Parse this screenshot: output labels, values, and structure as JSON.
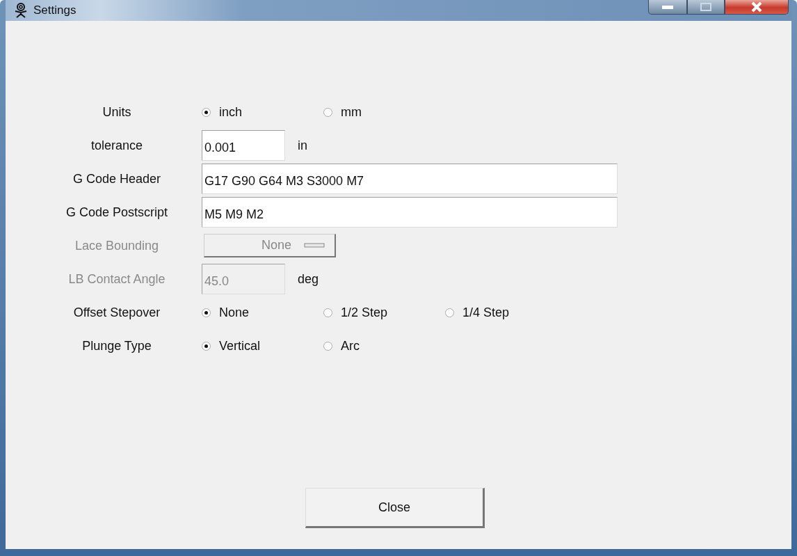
{
  "window": {
    "title": "Settings"
  },
  "rows": [
    {
      "kind": "radio",
      "label": "Units",
      "disabled": false,
      "options": [
        {
          "label": "inch",
          "selected": true
        },
        {
          "label": "mm",
          "selected": false
        }
      ]
    },
    {
      "kind": "field",
      "label": "tolerance",
      "disabled": false,
      "wide": false,
      "value": "0.001",
      "unit": "in"
    },
    {
      "kind": "field",
      "label": "G Code Header",
      "disabled": false,
      "wide": true,
      "value": "G17 G90 G64 M3 S3000 M7"
    },
    {
      "kind": "field",
      "label": "G Code Postscript",
      "disabled": false,
      "wide": true,
      "value": "M5 M9 M2"
    },
    {
      "kind": "dropdown",
      "label": "Lace Bounding",
      "disabled": true,
      "value": "None"
    },
    {
      "kind": "field",
      "label": "LB Contact Angle",
      "disabled": true,
      "wide": false,
      "value": "45.0",
      "unit": "deg"
    },
    {
      "kind": "radio",
      "label": "Offset Stepover",
      "disabled": false,
      "options": [
        {
          "label": "None",
          "selected": true
        },
        {
          "label": "1/2 Step",
          "selected": false
        },
        {
          "label": "1/4 Step",
          "selected": false
        }
      ]
    },
    {
      "kind": "radio",
      "label": "Plunge Type",
      "disabled": false,
      "options": [
        {
          "label": "Vertical",
          "selected": true
        },
        {
          "label": "Arc",
          "selected": false
        }
      ]
    }
  ],
  "close_button": "Close"
}
